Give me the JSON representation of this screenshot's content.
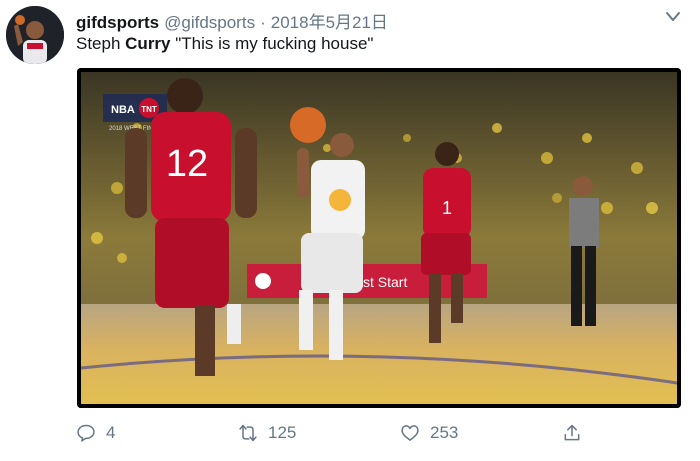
{
  "tweet": {
    "display_name": "gifdsports",
    "handle": "@gifdsports",
    "separator": "·",
    "timestamp": "2018年5月21日",
    "text_prefix": "Steph ",
    "text_bold_name": "Curry",
    "text_quote": " \"This is my fucking house\""
  },
  "media": {
    "scoreboard": "NBA",
    "network": "TNT",
    "subtitle": "2018 WEST FINALS",
    "jersey_rockets_back": "12",
    "jersey_rockets_front": "1",
    "ad_board": "Chase Fast Start",
    "ad_board_2": "Fast Start"
  },
  "actions": {
    "reply_count": "4",
    "retweet_count": "125",
    "like_count": "253"
  },
  "colors": {
    "text_primary": "#14171a",
    "text_secondary": "#657786",
    "rockets_red": "#c8102e",
    "warriors_white": "#f2f2f2",
    "court_wood": "#d9a646"
  },
  "icons": [
    "avatar",
    "chevron-down-icon",
    "reply-icon",
    "retweet-icon",
    "like-icon",
    "share-icon"
  ]
}
